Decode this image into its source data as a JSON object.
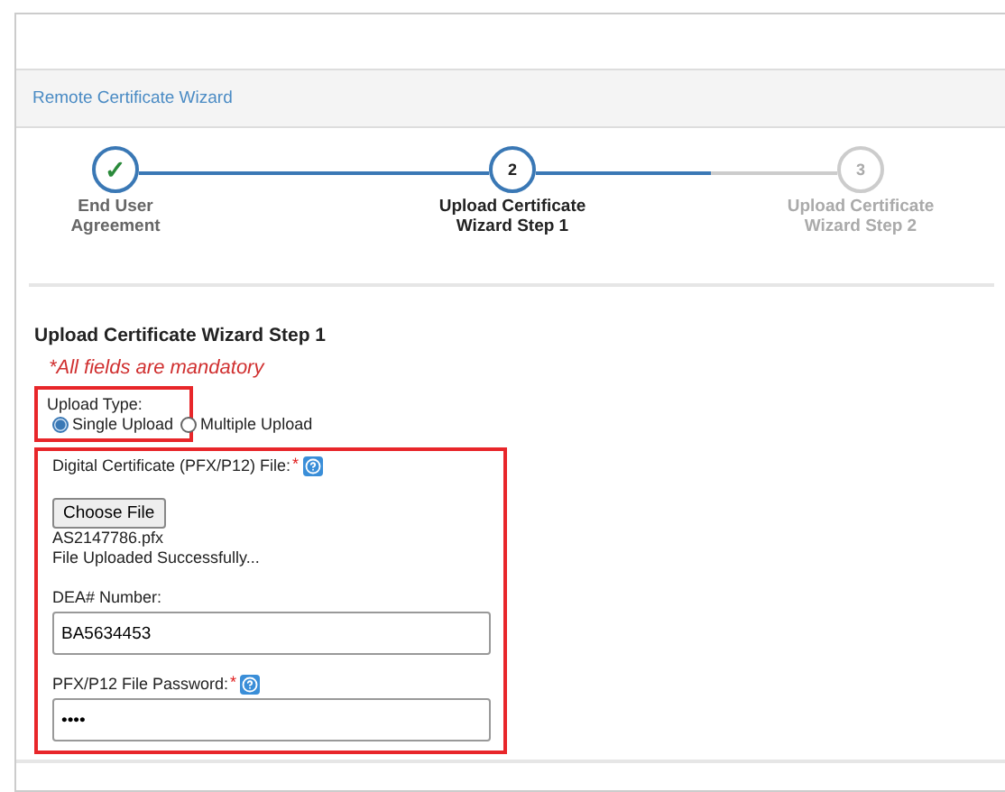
{
  "panel": {
    "title": "Remote Certificate Wizard"
  },
  "steps": [
    {
      "marker": "✓",
      "label": "End User Agreement",
      "completed": true,
      "selected": false
    },
    {
      "marker": "2",
      "label": "Upload Certificate Wizard Step 1",
      "completed": false,
      "selected": true
    },
    {
      "marker": "3",
      "label": "Upload Certificate Wizard Step 2",
      "completed": false,
      "selected": false
    }
  ],
  "form": {
    "heading": "Upload Certificate Wizard Step 1",
    "notice": "*All fields are mandatory",
    "upload_type": {
      "label": "Upload Type:",
      "highlighted": true,
      "options": [
        {
          "label": "Single Upload",
          "selected": true
        },
        {
          "label": "Multiple Upload",
          "selected": false
        }
      ]
    },
    "details": {
      "highlighted": true,
      "file_label": "Digital Certificate (PFX/P12) File:",
      "file_required": "*",
      "choose_button": "Choose File",
      "file_name": "AS2147786.pfx",
      "status": "File Uploaded Successfully...",
      "dea_label": "DEA# Number:",
      "dea_value": "BA5634453",
      "password_label": "PFX/P12 File Password:",
      "password_required": "*",
      "password_value": "••••"
    }
  }
}
